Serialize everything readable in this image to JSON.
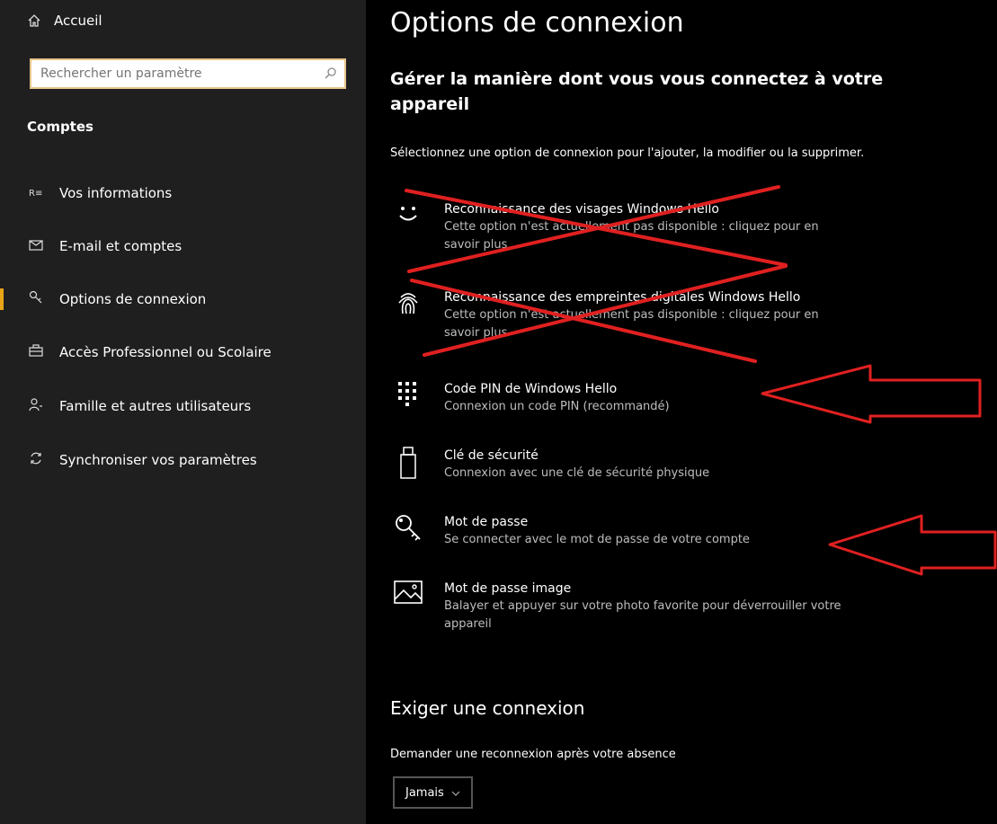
{
  "sidebar": {
    "home_label": "Accueil",
    "search_placeholder": "Rechercher un paramètre",
    "section_title": "Comptes",
    "items": [
      {
        "label": "Vos informations",
        "icon": "user-card-icon",
        "active": false
      },
      {
        "label": "E-mail et comptes",
        "icon": "mail-icon",
        "active": false
      },
      {
        "label": "Options de connexion",
        "icon": "key-icon",
        "active": true
      },
      {
        "label": "Accès Professionnel ou Scolaire",
        "icon": "briefcase-icon",
        "active": false
      },
      {
        "label": "Famille et autres utilisateurs",
        "icon": "add-person-icon",
        "active": false
      },
      {
        "label": "Synchroniser vos paramètres",
        "icon": "sync-icon",
        "active": false
      }
    ]
  },
  "main": {
    "title": "Options de connexion",
    "subtitle": "Gérer la manière dont vous vous connectez à votre appareil",
    "description": "Sélectionnez une option de connexion pour l'ajouter, la modifier ou la supprimer.",
    "options": [
      {
        "title": "Reconnaissance des visages Windows Hello",
        "desc": "Cette option n'est actuellement pas disponible : cliquez pour en savoir plus",
        "icon": "face-icon",
        "crossed": true
      },
      {
        "title": "Reconnaissance des empreintes digitales Windows Hello",
        "desc": "Cette option n'est actuellement pas disponible : cliquez pour en savoir plus",
        "icon": "fingerprint-icon",
        "crossed": true
      },
      {
        "title": "Code PIN de Windows Hello",
        "desc": "Connexion un code PIN (recommandé)",
        "icon": "pin-keypad-icon",
        "crossed": false
      },
      {
        "title": "Clé de sécurité",
        "desc": "Connexion avec une clé de sécurité physique",
        "icon": "usb-key-icon",
        "crossed": false
      },
      {
        "title": "Mot de passe",
        "desc": "Se connecter avec le mot de passe de votre compte",
        "icon": "password-key-icon",
        "crossed": false
      },
      {
        "title": "Mot de passe image",
        "desc": "Balayer et appuyer sur votre photo favorite pour déverrouiller votre appareil",
        "icon": "picture-password-icon",
        "crossed": false
      }
    ],
    "require_section": {
      "title": "Exiger une connexion",
      "desc": "Demander une reconnexion après votre absence",
      "dropdown_value": "Jamais"
    }
  },
  "colors": {
    "sidebar_bg": "#1f1f1f",
    "main_bg": "#000000",
    "accent": "#e8a317",
    "annotation_red": "#e02020"
  }
}
